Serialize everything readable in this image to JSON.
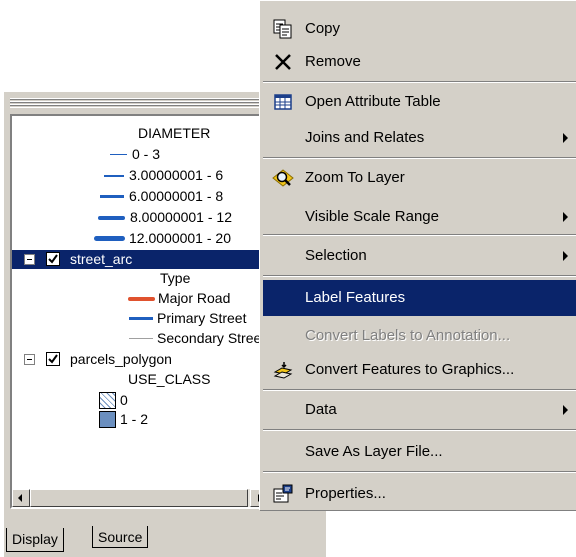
{
  "toc": {
    "tree": {
      "diameter_heading": "DIAMETER",
      "diameter_classes": [
        "0 - 3",
        "3.00000001 - 6",
        "6.00000001 - 8",
        "8.00000001 - 12",
        "12.0000001 - 20"
      ],
      "street_layer": "street_arc",
      "street_type_heading": "Type",
      "street_types": [
        "Major Road",
        "Primary Street",
        "Secondary Street"
      ],
      "parcels_layer": "parcels_polygon",
      "parcels_heading": "USE_CLASS",
      "parcels_classes": [
        "0",
        "1 - 2"
      ]
    },
    "tabs": [
      "Display",
      "Source"
    ]
  },
  "colors": {
    "selection": "#0a246a",
    "line_blue": "#1f5fbf",
    "major_road": "#e0522e",
    "secondary": "#a0a0a0",
    "face": "#d4d0c8"
  },
  "menu": {
    "items": [
      {
        "label": "Copy",
        "icon": "copy-icon"
      },
      {
        "label": "Remove",
        "icon": "remove-x-icon"
      },
      {
        "label": "Open Attribute Table",
        "icon": "attribute-table-icon"
      },
      {
        "label": "Joins and Relates",
        "submenu": true
      },
      {
        "label": "Zoom To Layer",
        "icon": "zoom-to-layer-icon"
      },
      {
        "label": "Visible Scale Range",
        "submenu": true
      },
      {
        "label": "Selection",
        "submenu": true
      },
      {
        "label": "Label Features",
        "highlighted": true
      },
      {
        "label": "Convert Labels to Annotation...",
        "disabled": true
      },
      {
        "label": "Convert Features to Graphics...",
        "icon": "convert-graphics-icon"
      },
      {
        "label": "Data",
        "submenu": true
      },
      {
        "label": "Save As Layer File..."
      },
      {
        "label": "Properties...",
        "icon": "properties-icon"
      }
    ]
  }
}
